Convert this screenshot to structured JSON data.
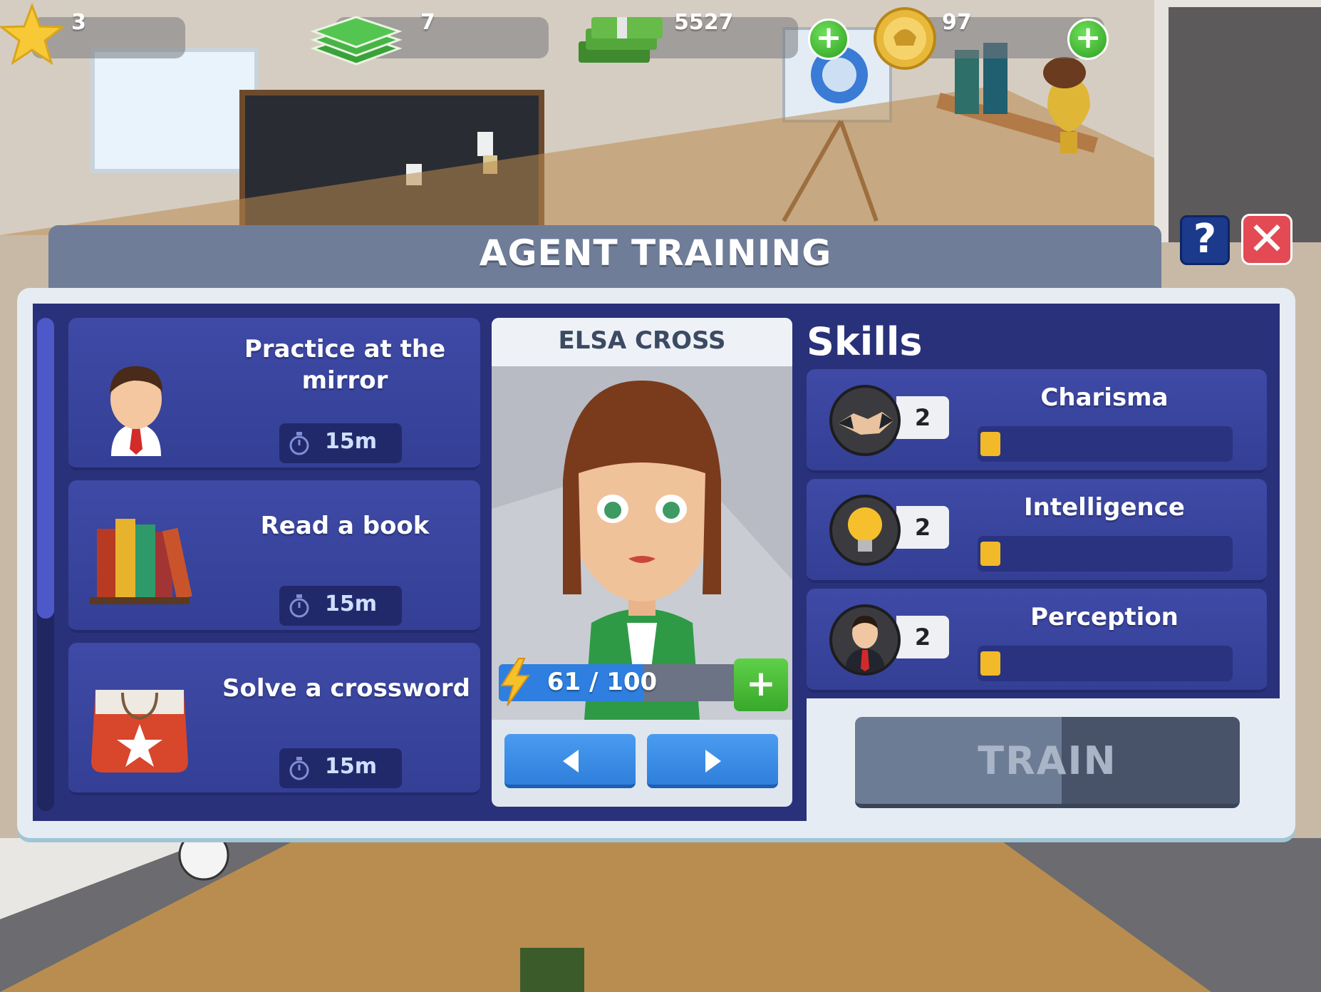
{
  "hud": {
    "stars": "3",
    "cards": "7",
    "cash": "5527",
    "coins": "97",
    "add_cash_label": "+",
    "add_coins_label": "+"
  },
  "dialog": {
    "title": "AGENT TRAINING",
    "help_label": "?",
    "close_label": "✕"
  },
  "tasks": [
    {
      "label": "Practice at the mirror",
      "time": "15m",
      "icon": "person-icon"
    },
    {
      "label": "Read a book",
      "time": "15m",
      "icon": "books-icon"
    },
    {
      "label": "Solve a crossword",
      "time": "15m",
      "icon": "gift-bag-icon"
    }
  ],
  "agent": {
    "name": "ELSA CROSS",
    "energy_text": "61 / 100",
    "energy_fraction": 0.61,
    "add_energy_label": "+"
  },
  "skills": {
    "title": "Skills",
    "items": [
      {
        "name": "Charisma",
        "level": "2",
        "icon": "handshake-icon",
        "progress": 0.05
      },
      {
        "name": "Intelligence",
        "level": "2",
        "icon": "lightbulb-icon",
        "progress": 0.05
      },
      {
        "name": "Perception",
        "level": "2",
        "icon": "agent-icon",
        "progress": 0.05
      }
    ]
  },
  "train": {
    "label": "TRAIN"
  },
  "colors": {
    "panel": "#29317a",
    "row": "#3e4aa6",
    "accent_green": "#38a82b",
    "accent_blue": "#2f7fdc",
    "close_red": "#e34a53",
    "skill_fill": "#f2b928"
  }
}
